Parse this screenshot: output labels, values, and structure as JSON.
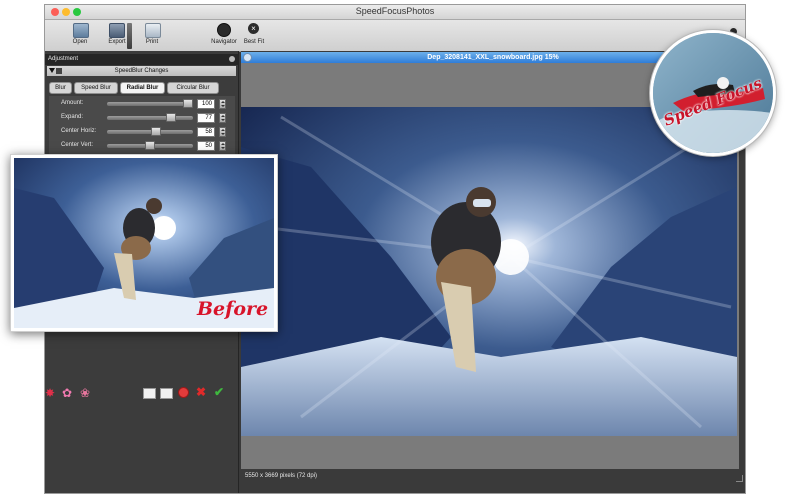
{
  "window": {
    "title": "SpeedFocusPhotos",
    "traffic_lights": [
      "#fc5f57",
      "#fdbc2e",
      "#28c840"
    ]
  },
  "toolbar": {
    "open_label": "Open",
    "export_label": "Export",
    "print_label": "Print",
    "navigator_label": "Navigator",
    "best_fit_label": "Best Fit",
    "open_icon": "open-folder-icon",
    "export_icon": "floppy-disk-icon",
    "print_icon": "printer-icon",
    "navigator_icon": "magnifier-icon",
    "best_fit_icon": "close-circle-icon",
    "help_icon": "lifebuoy-icon"
  },
  "panel": {
    "header": "Adjustment",
    "section_title": "SpeedBlur Changes",
    "tabs": [
      "Blur",
      "Speed Blur",
      "Radial Blur",
      "Circular Blur"
    ],
    "active_tab": "Radial Blur",
    "sliders": [
      {
        "label": "Amount:",
        "value": "100",
        "fraction": 1.0
      },
      {
        "label": "Expand:",
        "value": "77",
        "fraction": 0.77
      },
      {
        "label": "Center Horiz:",
        "value": "58",
        "fraction": 0.58
      },
      {
        "label": "Center Vert:",
        "value": "50",
        "fraction": 0.5
      }
    ],
    "bottom_icons_left": [
      "red-flower-icon",
      "pink-flowers-icon",
      "pink-cluster-icon"
    ],
    "bottom_icons_right": [
      "mail-out-icon",
      "mail-in-icon",
      "no-entry-icon",
      "delete-icon",
      "confirm-check-icon"
    ]
  },
  "document": {
    "title": "Dep_3208141_XXL_snowboard.jpg 15%",
    "status": "5550 x 3669 pixels (72 dpi)"
  },
  "overlay": {
    "before_label": "Before"
  },
  "logo": {
    "text": "Speed Focus"
  },
  "colors": {
    "title_blue": "#2f7dd8",
    "before_red": "#d8142a",
    "sky": "#1b2e5a"
  }
}
